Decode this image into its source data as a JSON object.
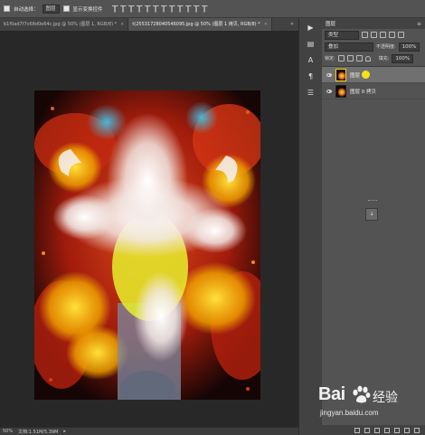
{
  "options_bar": {
    "auto_select_label": "自动选择：",
    "auto_select_value": "图层",
    "show_transform_label": "显示变换控件"
  },
  "tabs": [
    {
      "label": "b1f0ad7f7c68d0e64c.jpg @ 50% (图层 1, RGB/8) *",
      "active": false
    },
    {
      "label": "t(25531728040546095.jpg @ 50% (图层 1 拷贝, RGB/8) *",
      "active": true
    }
  ],
  "status": {
    "zoom": "50%",
    "doc_info": "文档:1.51M/5.39M"
  },
  "layers_panel": {
    "tab_label": "图层",
    "filter_kind": "类型",
    "blend_mode": "叠加",
    "opacity_label": "不透明度:",
    "opacity_value": "100%",
    "lock_label": "锁定:",
    "fill_label": "填充:",
    "fill_value": "100%",
    "layers": [
      {
        "name": "图层",
        "selected": true
      },
      {
        "name": "图层 0 拷贝",
        "selected": false
      }
    ]
  },
  "watermark": {
    "brand": "Bai",
    "brand_suffix": "经验",
    "url": "jingyan.baidu.com"
  }
}
